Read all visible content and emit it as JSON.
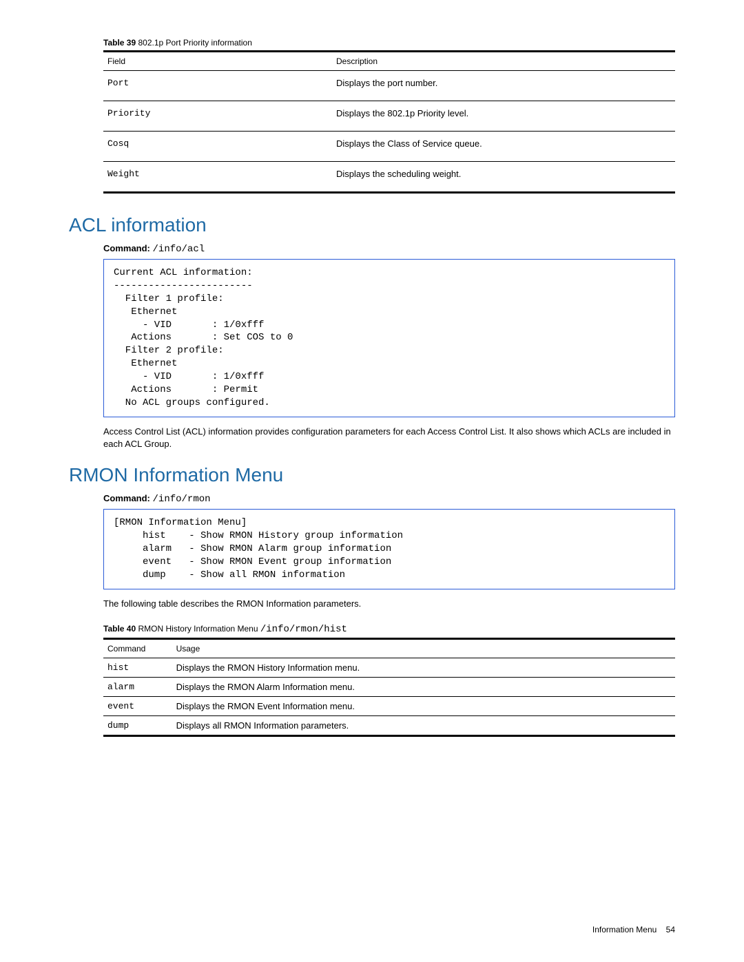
{
  "table39": {
    "caption_label": "Table 39",
    "caption_text": "802.1p Port Priority information",
    "head_field": "Field",
    "head_desc": "Description",
    "rows": [
      {
        "field": "Port",
        "desc": "Displays the port number."
      },
      {
        "field": "Priority",
        "desc": "Displays the 802.1p Priority level."
      },
      {
        "field": "Cosq",
        "desc": "Displays the Class of Service queue."
      },
      {
        "field": "Weight",
        "desc": "Displays the scheduling weight."
      }
    ]
  },
  "acl": {
    "heading": "ACL information",
    "command_label": "Command:",
    "command_value": "/info/acl",
    "code": "Current ACL information:\n------------------------\n  Filter 1 profile:\n   Ethernet\n     - VID       : 1/0xfff\n   Actions       : Set COS to 0\n  Filter 2 profile:\n   Ethernet\n     - VID       : 1/0xfff\n   Actions       : Permit\n  No ACL groups configured.",
    "paragraph": "Access Control List (ACL) information provides configuration parameters for each Access Control List. It also shows which ACLs are included in each ACL Group."
  },
  "rmon": {
    "heading": "RMON Information Menu",
    "command_label": "Command:",
    "command_value": "/info/rmon",
    "code": "[RMON Information Menu]\n     hist    - Show RMON History group information\n     alarm   - Show RMON Alarm group information\n     event   - Show RMON Event group information\n     dump    - Show all RMON information",
    "paragraph": "The following table describes the RMON Information parameters."
  },
  "table40": {
    "caption_label": "Table 40",
    "caption_text": "RMON History Information Menu",
    "caption_cmd": "/info/rmon/hist",
    "head_cmd": "Command",
    "head_usage": "Usage",
    "rows": [
      {
        "cmd": "hist",
        "usage": "Displays the RMON History Information menu."
      },
      {
        "cmd": "alarm",
        "usage": "Displays the RMON Alarm Information menu."
      },
      {
        "cmd": "event",
        "usage": "Displays the RMON Event Information menu."
      },
      {
        "cmd": "dump",
        "usage": "Displays all RMON Information parameters."
      }
    ]
  },
  "footer": {
    "text": "Information Menu",
    "page": "54"
  }
}
